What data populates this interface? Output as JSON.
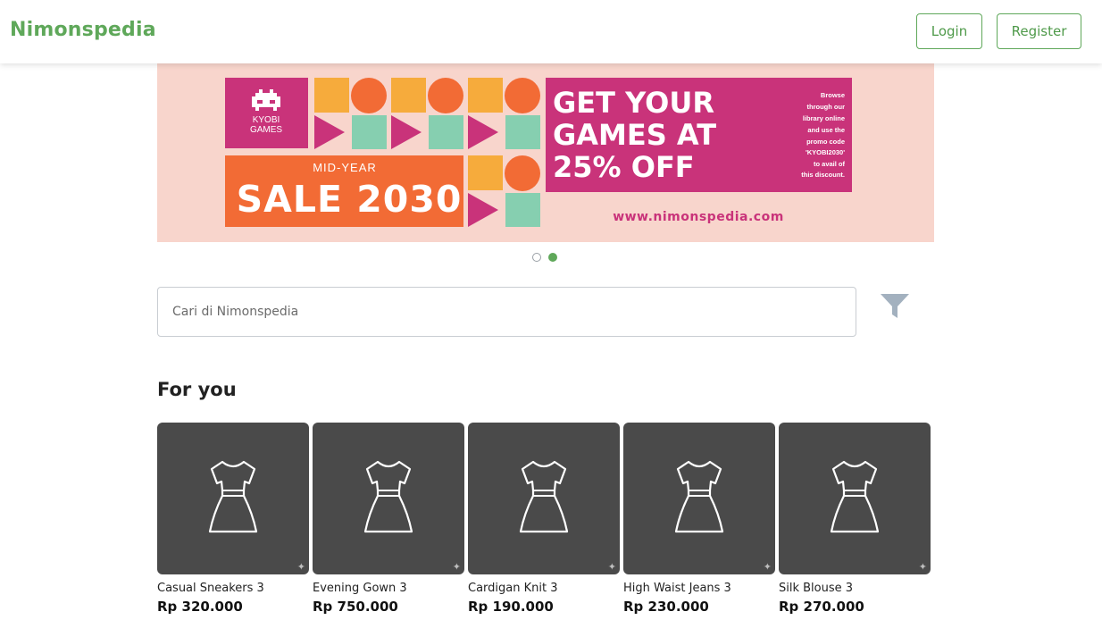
{
  "header": {
    "brand": "Nimonspedia",
    "login_label": "Login",
    "register_label": "Register"
  },
  "banner": {
    "brand_line1": "KYOBI",
    "brand_line2": "GAMES",
    "sale_small": "MID-YEAR",
    "sale_big": "SALE 2030",
    "headline": [
      "GET YOUR",
      "GAMES AT",
      "25% OFF"
    ],
    "side_text": [
      "Browse",
      "through our",
      "library online",
      "and use the",
      "promo code",
      "'KYOBI2030'",
      "to avail of",
      "this discount."
    ],
    "url": "www.nimonspedia.com",
    "colors": {
      "background": "#f8d5cc",
      "magenta": "#c9337a",
      "orange": "#f26b35",
      "yellow": "#f6ab3c",
      "mint": "#86cfb0"
    }
  },
  "carousel": {
    "slide_count": 2,
    "active_index": 1
  },
  "search": {
    "placeholder": "Cari di Nimonspedia",
    "value": ""
  },
  "section": {
    "title": "For you"
  },
  "products": [
    {
      "name": "Casual Sneakers 3",
      "price": "Rp 320.000",
      "icon": "dress-icon"
    },
    {
      "name": "Evening Gown 3",
      "price": "Rp 750.000",
      "icon": "dress-icon"
    },
    {
      "name": "Cardigan Knit 3",
      "price": "Rp 190.000",
      "icon": "dress-icon"
    },
    {
      "name": "High Waist Jeans 3",
      "price": "Rp 230.000",
      "icon": "dress-icon"
    },
    {
      "name": "Silk Blouse 3",
      "price": "Rp 270.000",
      "icon": "dress-icon"
    }
  ],
  "colors": {
    "accent": "#5fa85a",
    "thumb_bg": "#4a4a4a"
  }
}
